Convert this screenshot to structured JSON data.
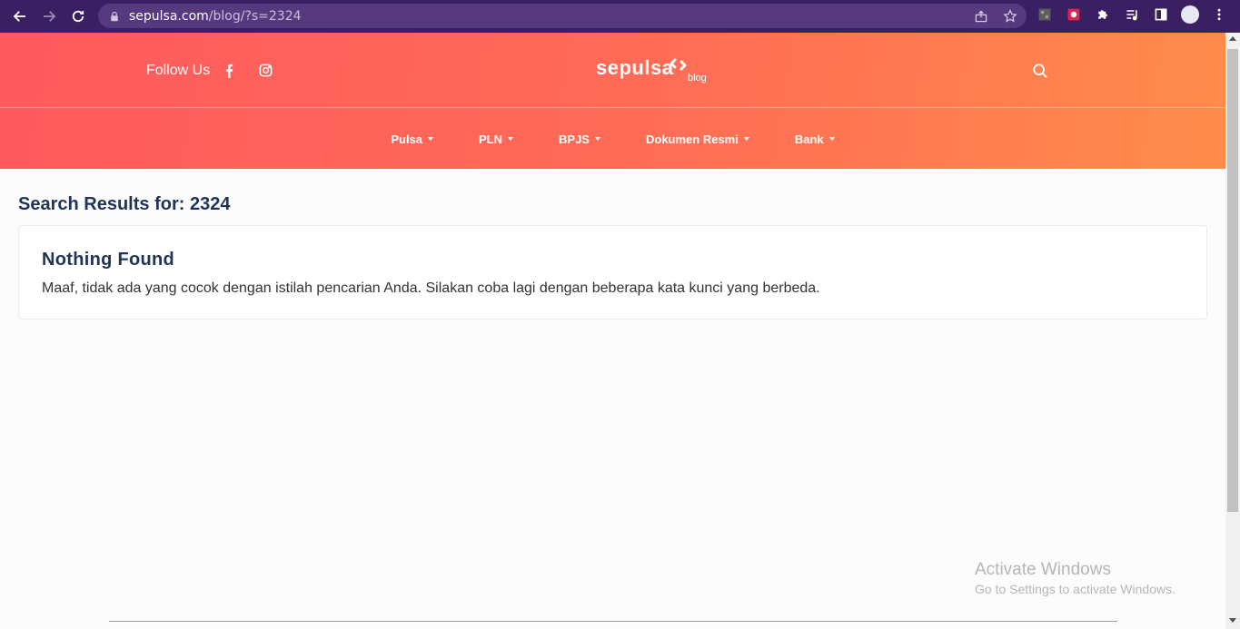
{
  "browser": {
    "url_host": "sepulsa.com",
    "url_path": "/blog/?s=2324"
  },
  "header": {
    "follow_label": "Follow Us",
    "logo_text": "sepulsa",
    "logo_sub": "blog"
  },
  "menu": [
    {
      "label": "Pulsa"
    },
    {
      "label": "PLN"
    },
    {
      "label": "BPJS"
    },
    {
      "label": "Dokumen Resmi"
    },
    {
      "label": "Bank"
    }
  ],
  "results": {
    "title": "Search Results for: 2324",
    "card_title": "Nothing Found",
    "card_text": "Maaf, tidak ada yang cocok dengan istilah pencarian Anda. Silakan coba lagi dengan beberapa kata kunci yang berbeda."
  },
  "watermark": {
    "line1": "Activate Windows",
    "line2": "Go to Settings to activate Windows."
  },
  "colors": {
    "header_start": "#ff5a5e",
    "header_end": "#ff8c4b",
    "title": "#1f3357",
    "chrome": "#3b1f63"
  }
}
